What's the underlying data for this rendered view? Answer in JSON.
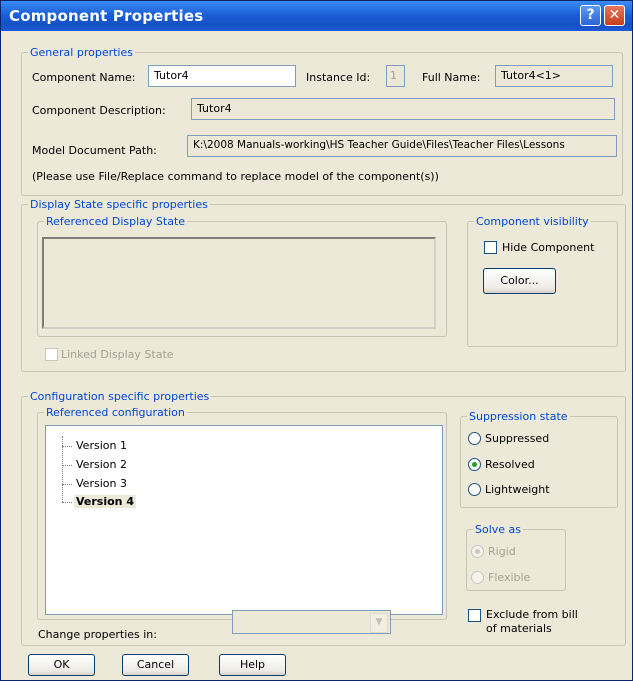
{
  "window": {
    "title": "Component Properties",
    "help_glyph": "?",
    "close_glyph": "✕"
  },
  "general": {
    "legend": "General properties",
    "component_name_label": "Component Name:",
    "component_name": "Tutor4",
    "instance_id_label": "Instance Id:",
    "instance_id": "1",
    "full_name_label": "Full Name:",
    "full_name": "Tutor4<1>",
    "description_label": "Component Description:",
    "description": "Tutor4",
    "model_path_label": "Model Document Path:",
    "model_path": "K:\\2008 Manuals-working\\HS Teacher Guide\\Files\\Teacher Files\\Lessons",
    "note": "(Please use File/Replace command to replace model of the component(s))"
  },
  "display_state": {
    "legend": "Display State specific properties",
    "referenced_legend": "Referenced Display State",
    "linked_label": "Linked Display State",
    "visibility_legend": "Component visibility",
    "hide_label": "Hide Component",
    "color_button": "Color..."
  },
  "configuration": {
    "legend": "Configuration specific properties",
    "referenced_legend": "Referenced configuration",
    "items": [
      "Version 1",
      "Version 2",
      "Version 3",
      "Version 4"
    ],
    "selected": "Version 4",
    "change_label": "Change properties in:",
    "change_value": ""
  },
  "suppression": {
    "legend": "Suppression state",
    "options": [
      "Suppressed",
      "Resolved",
      "Lightweight"
    ],
    "selected": "Resolved"
  },
  "solve_as": {
    "legend": "Solve as",
    "options": [
      "Rigid",
      "Flexible"
    ],
    "selected": "Rigid"
  },
  "exclude": {
    "label_line1": "Exclude from bill",
    "label_line2": "of materials"
  },
  "buttons": {
    "ok": "OK",
    "cancel": "Cancel",
    "help": "Help"
  }
}
